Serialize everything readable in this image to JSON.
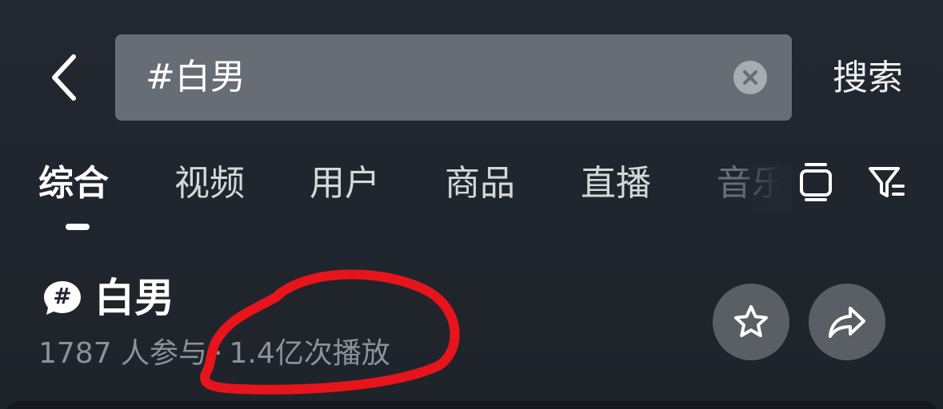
{
  "header": {
    "search_value": "#白男",
    "search_label": "搜索"
  },
  "tabs": [
    {
      "label": "综合",
      "active": true
    },
    {
      "label": "视频",
      "active": false
    },
    {
      "label": "用户",
      "active": false
    },
    {
      "label": "商品",
      "active": false
    },
    {
      "label": "直播",
      "active": false
    },
    {
      "label": "音乐",
      "active": false
    }
  ],
  "topic": {
    "badge": "#",
    "name": "白男",
    "participants": "1787 人参与",
    "separator": "·",
    "plays": "1.4亿次播放"
  },
  "icons": {
    "back": "chevron-left-icon",
    "clear": "clear-circle-icon",
    "tablet": "tablet-icon",
    "filter": "filter-icon",
    "star": "star-icon",
    "share": "share-arrow-icon",
    "topic": "hashtag-bubble-icon"
  },
  "colors": {
    "background": "#222830",
    "search_box": "#676d74",
    "circle_button": "#5a5f66",
    "muted_text": "#8c9299",
    "annotation": "#e8141c"
  }
}
